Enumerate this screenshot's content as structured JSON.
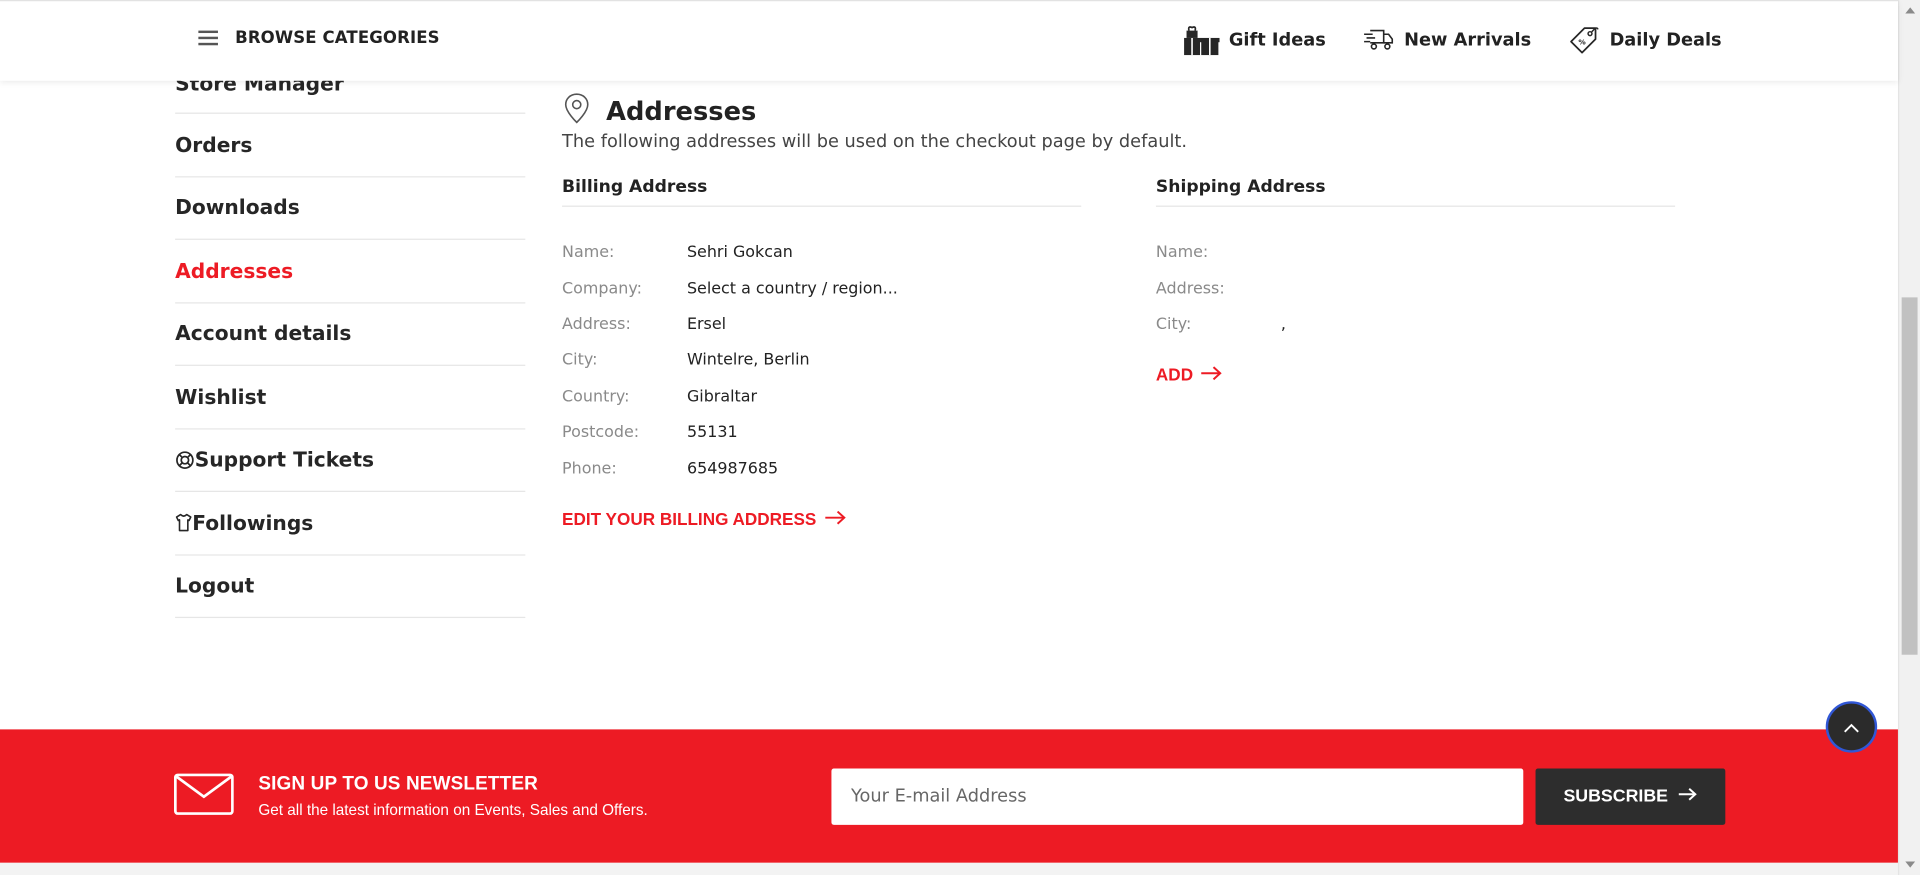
{
  "header": {
    "browse_label": "BROWSE CATEGORIES",
    "links": [
      {
        "label": "Gift Ideas",
        "icon": "gift-icon"
      },
      {
        "label": "New Arrivals",
        "icon": "delivery-icon"
      },
      {
        "label": "Daily Deals",
        "icon": "price-tag-icon"
      }
    ]
  },
  "sidebar": {
    "items": [
      {
        "label": "Store Manager"
      },
      {
        "label": "Orders"
      },
      {
        "label": "Downloads"
      },
      {
        "label": "Addresses",
        "active": true
      },
      {
        "label": "Account details"
      },
      {
        "label": "Wishlist"
      },
      {
        "label": "Support Tickets",
        "icon": "lifebuoy-icon"
      },
      {
        "label": "Followings",
        "icon": "shirt-icon"
      },
      {
        "label": "Logout"
      }
    ]
  },
  "addresses": {
    "title": "Addresses",
    "description": "The following addresses will be used on the checkout page by default.",
    "billing": {
      "title": "Billing Address",
      "fields": [
        {
          "label": "Name:",
          "value": "Sehri Gokcan"
        },
        {
          "label": "Company:",
          "value": "Select a country / region..."
        },
        {
          "label": "Address:",
          "value": "Ersel"
        },
        {
          "label": "City:",
          "value": "Wintelre, Berlin"
        },
        {
          "label": "Country:",
          "value": "Gibraltar"
        },
        {
          "label": "Postcode:",
          "value": "55131"
        },
        {
          "label": "Phone:",
          "value": "654987685"
        }
      ],
      "action_label": "EDIT YOUR BILLING ADDRESS"
    },
    "shipping": {
      "title": "Shipping Address",
      "fields": [
        {
          "label": "Name:",
          "value": ""
        },
        {
          "label": "Address:",
          "value": ""
        },
        {
          "label": "City:",
          "value": ","
        }
      ],
      "action_label": "ADD"
    }
  },
  "newsletter": {
    "title": "SIGN UP TO US NEWSLETTER",
    "subtitle": "Get all the latest information on Events, Sales and Offers.",
    "input_placeholder": "Your E-mail Address",
    "button_label": "SUBSCRIBE"
  },
  "colors": {
    "accent": "#ed1b24",
    "dark": "#2d2d2d"
  }
}
